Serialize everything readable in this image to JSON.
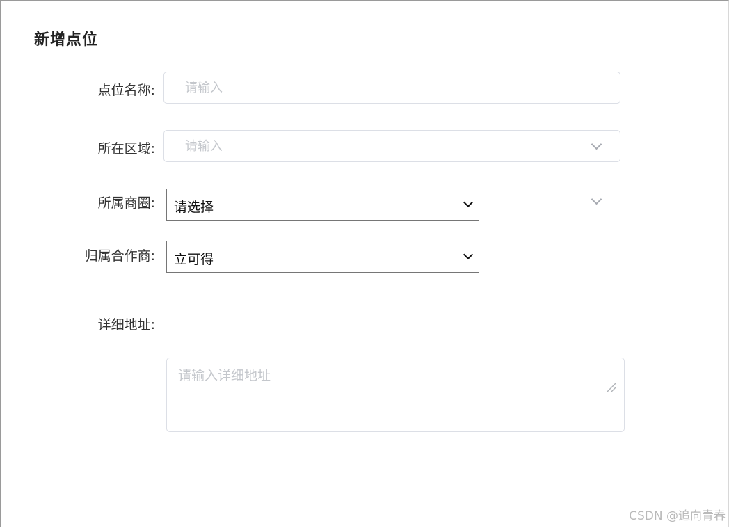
{
  "dialog": {
    "title": "新增点位"
  },
  "form": {
    "point_name": {
      "label": "点位名称:",
      "placeholder": "请输入",
      "value": ""
    },
    "region": {
      "label": "所在区域:",
      "placeholder": "请输入",
      "icon": "chevron-down-icon"
    },
    "business_circle": {
      "label": "所属商圈:",
      "selected": "请选择",
      "icon": "chevron-down-icon"
    },
    "partner": {
      "label": "归属合作商:",
      "selected": "立可得"
    },
    "address": {
      "label": "详细地址:",
      "placeholder": "请输入详细地址",
      "value": ""
    }
  },
  "watermark": "CSDN @追向青春",
  "colors": {
    "border": "#dcdfe6",
    "placeholder": "#c4c7cc",
    "label": "#333333",
    "native_select_border": "#767676"
  }
}
